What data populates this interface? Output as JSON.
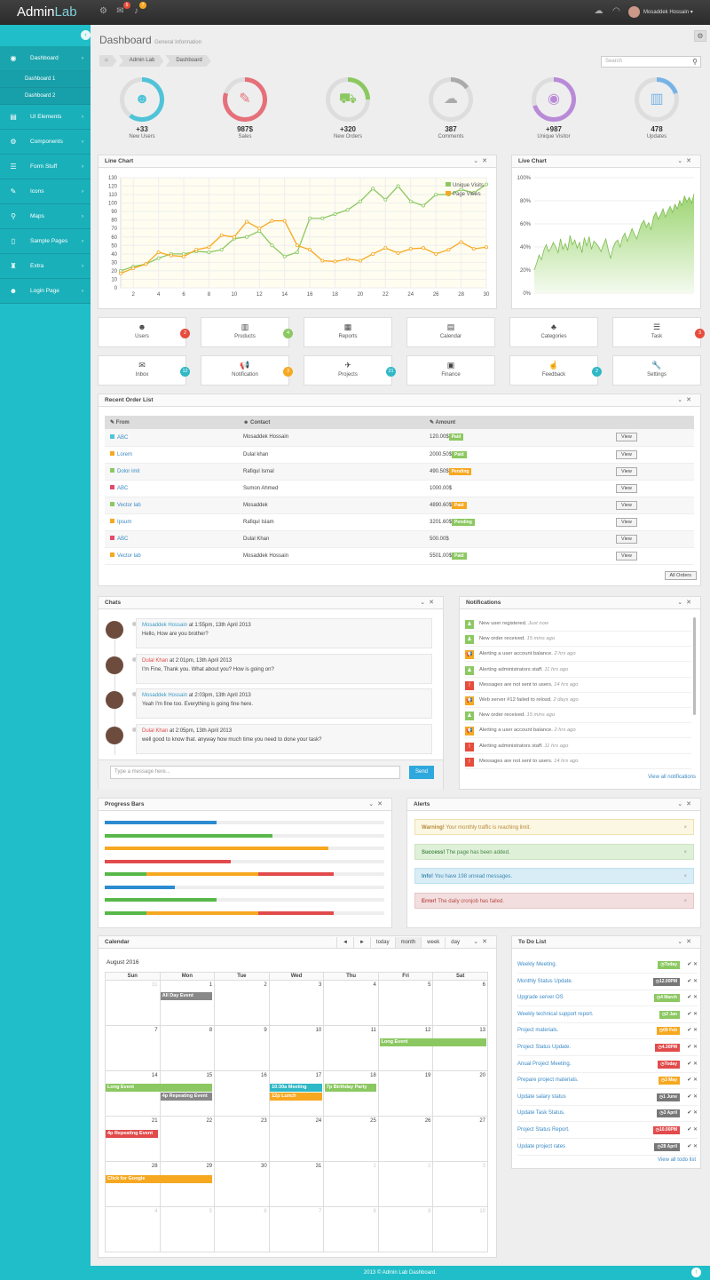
{
  "app": {
    "logo_a": "Admin",
    "logo_b": "Lab",
    "user": "Mosaddek Hossain",
    "mail_badge": "5",
    "bell_badge": "7"
  },
  "sidebar": {
    "items": [
      {
        "label": "Dashboard",
        "icon": "dashboard-icon",
        "glyph": "◉"
      },
      {
        "label": "UI Elements",
        "icon": "book-icon",
        "glyph": "▤"
      },
      {
        "label": "Components",
        "icon": "cogs-icon",
        "glyph": "⚙"
      },
      {
        "label": "Form Stuff",
        "icon": "list-icon",
        "glyph": "☰"
      },
      {
        "label": "Icons",
        "icon": "tint-icon",
        "glyph": "✎"
      },
      {
        "label": "Maps",
        "icon": "map-marker-icon",
        "glyph": "⚲"
      },
      {
        "label": "Sample Pages",
        "icon": "file-icon",
        "glyph": "▯"
      },
      {
        "label": "Extra",
        "icon": "trophy-icon",
        "glyph": "♜"
      },
      {
        "label": "Login Page",
        "icon": "user-icon",
        "glyph": "☻"
      }
    ],
    "sub": [
      "Dashboard 1",
      "Dashboard 2"
    ]
  },
  "page": {
    "title": "Dashboard",
    "subtitle": "General Information",
    "breadcrumb": [
      "⌂",
      "Admin Lab",
      "Dashboard"
    ],
    "search_placeholder": "Search"
  },
  "stats": [
    {
      "value": "+33",
      "label": "New Users",
      "color": "#4fc3d8",
      "pct": 0.6,
      "glyph": "☻"
    },
    {
      "value": "987$",
      "label": "Sales",
      "color": "#e5707a",
      "pct": 0.8,
      "glyph": "✎"
    },
    {
      "value": "+320",
      "label": "New Orders",
      "color": "#8cc862",
      "pct": 0.25,
      "glyph": "⛟"
    },
    {
      "value": "387",
      "label": "Comments",
      "color": "#aaaaaa",
      "pct": 0.15,
      "glyph": "☁"
    },
    {
      "value": "+987",
      "label": "Unique Visitor",
      "color": "#b98ad8",
      "pct": 0.7,
      "glyph": "◉"
    },
    {
      "value": "478",
      "label": "Updates",
      "color": "#79b3e5",
      "pct": 0.2,
      "glyph": "▥"
    }
  ],
  "line_panel": {
    "title": "Line Chart"
  },
  "live_panel": {
    "title": "Live Chart"
  },
  "chart_data": [
    {
      "type": "line",
      "ylim": [
        0,
        130
      ],
      "yticks": [
        0,
        10,
        20,
        30,
        40,
        50,
        60,
        70,
        80,
        90,
        100,
        110,
        120,
        130
      ],
      "xticks": [
        2,
        4,
        6,
        8,
        10,
        12,
        14,
        16,
        18,
        20,
        22,
        24,
        26,
        28,
        30
      ],
      "x": [
        1,
        2,
        3,
        4,
        5,
        6,
        7,
        8,
        9,
        10,
        11,
        12,
        13,
        14,
        15,
        16,
        17,
        18,
        19,
        20,
        21,
        22,
        23,
        24,
        25,
        26,
        27,
        28,
        29,
        30
      ],
      "series": [
        {
          "name": "Unique Visits",
          "color": "#8cc862",
          "values": [
            20,
            25,
            28,
            35,
            40,
            40,
            43,
            42,
            45,
            58,
            60,
            67,
            50,
            37,
            42,
            82,
            82,
            87,
            92,
            102,
            117,
            104,
            120,
            102,
            97,
            110,
            110,
            116,
            112,
            122
          ]
        },
        {
          "name": "Page Views",
          "color": "#f6a821",
          "values": [
            17,
            23,
            28,
            42,
            38,
            37,
            45,
            48,
            62,
            60,
            78,
            70,
            79,
            79,
            50,
            45,
            32,
            31,
            34,
            32,
            40,
            47,
            41,
            46,
            47,
            40,
            45,
            54,
            46,
            48
          ]
        }
      ]
    },
    {
      "type": "area",
      "ylim": [
        0,
        100
      ],
      "yticks": [
        "0%",
        "20%",
        "40%",
        "60%",
        "80%",
        "100%"
      ],
      "series": [
        {
          "color": "#9cd472",
          "values": [
            20,
            26,
            33,
            29,
            37,
            42,
            36,
            39,
            44,
            40,
            35,
            47,
            38,
            43,
            37,
            50,
            42,
            46,
            39,
            44,
            35,
            48,
            41,
            49,
            38,
            45,
            43,
            40,
            36,
            42,
            47,
            38,
            30,
            39,
            44,
            46,
            40,
            48,
            52,
            45,
            50,
            56,
            51,
            47,
            54,
            60,
            63,
            57,
            61,
            55,
            66,
            70,
            64,
            68,
            73,
            66,
            71,
            75,
            70,
            77,
            73,
            80,
            76,
            84,
            79,
            83,
            78,
            86
          ]
        }
      ]
    }
  ],
  "tiles": [
    {
      "label": "Users",
      "glyph": "☻",
      "icon": "users-icon",
      "badge": "2",
      "bcolor": "#e74c3c"
    },
    {
      "label": "Products",
      "glyph": "▥",
      "icon": "barcode-icon",
      "badge": "4",
      "bcolor": "#8cc862"
    },
    {
      "label": "Reports",
      "glyph": "▦",
      "icon": "bar-chart-icon",
      "badge": "",
      "bcolor": ""
    },
    {
      "label": "Calendar",
      "glyph": "▤",
      "icon": "calendar-icon",
      "badge": "",
      "bcolor": ""
    },
    {
      "label": "Categories",
      "glyph": "♣",
      "icon": "sitemap-icon",
      "badge": "",
      "bcolor": ""
    },
    {
      "label": "Task",
      "glyph": "☰",
      "icon": "tasks-icon",
      "badge": "3",
      "bcolor": "#e74c3c"
    },
    {
      "label": "Inbox",
      "glyph": "✉",
      "icon": "inbox-icon",
      "badge": "12",
      "bcolor": "#2fb8c6"
    },
    {
      "label": "Notification",
      "glyph": "📢",
      "icon": "bullhorn-icon",
      "badge": "3",
      "bcolor": "#f6a821"
    },
    {
      "label": "Projects",
      "glyph": "✈",
      "icon": "plane-icon",
      "badge": "21",
      "bcolor": "#2fb8c6"
    },
    {
      "label": "Finance",
      "glyph": "▣",
      "icon": "money-icon",
      "badge": "",
      "bcolor": ""
    },
    {
      "label": "Feedback",
      "glyph": "☝",
      "icon": "thumbs-up-icon",
      "badge": "2",
      "bcolor": "#2fb8c6"
    },
    {
      "label": "Settings",
      "glyph": "🔧",
      "icon": "wrench-icon",
      "badge": "",
      "bcolor": ""
    }
  ],
  "orders": {
    "title": "Recent Order List",
    "headers": [
      "From",
      "Contact",
      "Amount"
    ],
    "view_label": "View",
    "all_label": "All Orders",
    "rows": [
      {
        "from": "ABC",
        "color": "#4fc3d8",
        "contact": "Mosaddek Hossain",
        "amount": "120.00$",
        "status": "Paid",
        "scolor": "#8cc862"
      },
      {
        "from": "Lorem",
        "color": "#f6a821",
        "contact": "Dulal khan",
        "amount": "2000.50$",
        "status": "Paid",
        "scolor": "#8cc862"
      },
      {
        "from": "Dolor imit",
        "color": "#8cc862",
        "contact": "Rafiqul Ismal",
        "amount": "490.50$",
        "status": "Pending",
        "scolor": "#f6a821"
      },
      {
        "from": "ABC",
        "color": "#e24b6b",
        "contact": "Sumon Ahmed",
        "amount": "1000.00$",
        "status": "",
        "scolor": ""
      },
      {
        "from": "Vector lab",
        "color": "#8cc862",
        "contact": "Mosaddek",
        "amount": "4890.60$",
        "status": "Paid",
        "scolor": "#f6a821"
      },
      {
        "from": "Ipsum",
        "color": "#f6a821",
        "contact": "Rafiqul Islam",
        "amount": "3201.60$",
        "status": "Pending",
        "scolor": "#8cc862"
      },
      {
        "from": "ABC",
        "color": "#e24b6b",
        "contact": "Dulal Khan",
        "amount": "500.00$",
        "status": "",
        "scolor": ""
      },
      {
        "from": "Vector lab",
        "color": "#f6a821",
        "contact": "Mosaddek Hossain",
        "amount": "5501.00$",
        "status": "Paid",
        "scolor": "#8cc862"
      }
    ]
  },
  "chats": {
    "title": "Chats",
    "placeholder": "Type a message here...",
    "send": "Send",
    "messages": [
      {
        "who": "Mosaddek Hossain",
        "at": "at 1:55pm, 13th April 2013",
        "text": "Hello, How are you brother?",
        "red": false
      },
      {
        "who": "Dulal Khan",
        "at": "at 2:01pm, 13th April 2013",
        "text": "I'm Fine, Thank you. What about you? How is going on?",
        "red": true
      },
      {
        "who": "Mosaddek Hossain",
        "at": "at 2:03pm, 13th April 2013",
        "text": "Yeah I'm fine too. Everything is going fine here.",
        "red": false
      },
      {
        "who": "Dulal Khan",
        "at": "at 2:05pm, 13th April 2013",
        "text": "well good to know that. anyway how much time you need to done your task?",
        "red": true
      }
    ]
  },
  "notifications": {
    "title": "Notifications",
    "view_all": "View all notifications",
    "items": [
      {
        "text": "New user registered.",
        "time": "Just now",
        "color": "#8cc862",
        "glyph": "♟"
      },
      {
        "text": "New order received.",
        "time": "15 mins ago",
        "color": "#8cc862",
        "glyph": "♟"
      },
      {
        "text": "Alerting a user account balance.",
        "time": "2 hrs ago",
        "color": "#f6a821",
        "glyph": "📢"
      },
      {
        "text": "Alerting administrators staff.",
        "time": "11 hrs ago",
        "color": "#8cc862",
        "glyph": "♟"
      },
      {
        "text": "Messages are not sent to users.",
        "time": "14 hrs ago",
        "color": "#e74c3c",
        "glyph": "!"
      },
      {
        "text": "Web server #12 failed to relosd.",
        "time": "2 days ago",
        "color": "#f6a821",
        "glyph": "📢"
      },
      {
        "text": "New order received.",
        "time": "15 mins ago",
        "color": "#8cc862",
        "glyph": "♟"
      },
      {
        "text": "Alerting a user account balance.",
        "time": "2 hrs ago",
        "color": "#f6a821",
        "glyph": "📢"
      },
      {
        "text": "Alerting administrators staff.",
        "time": "11 hrs ago",
        "color": "#e74c3c",
        "glyph": "!"
      },
      {
        "text": "Messages are not sent to users.",
        "time": "14 hrs ago",
        "color": "#e74c3c",
        "glyph": "!"
      }
    ]
  },
  "progress": {
    "title": "Progress Bars",
    "bars": [
      [
        {
          "c": "#2d8bd0",
          "v": 0.4
        }
      ],
      [
        {
          "c": "#57b849",
          "v": 0.6
        }
      ],
      [
        {
          "c": "#f6a821",
          "v": 0.8
        }
      ],
      [
        {
          "c": "#e24b4b",
          "v": 0.45
        }
      ],
      [
        {
          "c": "#57b849",
          "v": 0.15
        },
        {
          "c": "#f6a821",
          "v": 0.4
        },
        {
          "c": "#e24b4b",
          "v": 0.27
        }
      ],
      [
        {
          "c": "#2d8bd0",
          "v": 0.25
        }
      ],
      [
        {
          "c": "#57b849",
          "v": 0.4
        }
      ],
      [
        {
          "c": "#57b849",
          "v": 0.15
        },
        {
          "c": "#f6a821",
          "v": 0.4
        },
        {
          "c": "#e24b4b",
          "v": 0.27
        }
      ]
    ]
  },
  "alerts": {
    "title": "Alerts",
    "items": [
      {
        "strong": "Warning!",
        "text": "Your monthly traffic is reaching limit.",
        "bg": "#fcf7e2",
        "bd": "#f0e1b0",
        "fg": "#b5893b"
      },
      {
        "strong": "Success!",
        "text": "The page has been added.",
        "bg": "#dff0d8",
        "bd": "#cde3c2",
        "fg": "#468847"
      },
      {
        "strong": "Info!",
        "text": "You have 198 unread messages.",
        "bg": "#d9edf7",
        "bd": "#bde0ee",
        "fg": "#3a87ad"
      },
      {
        "strong": "Error!",
        "text": "The daily cronjob has failed.",
        "bg": "#f2dede",
        "bd": "#e6c5c5",
        "fg": "#b94a48"
      }
    ]
  },
  "calendar": {
    "title": "Calendar",
    "month": "August 2016",
    "buttons": [
      "◄",
      "►",
      "today",
      "month",
      "week",
      "day"
    ],
    "days": [
      "Sun",
      "Mon",
      "Tue",
      "Wed",
      "Thu",
      "Fri",
      "Sat"
    ],
    "weeks": [
      [
        "31",
        "1",
        "2",
        "3",
        "4",
        "5",
        "6"
      ],
      [
        "7",
        "8",
        "9",
        "10",
        "11",
        "12",
        "13"
      ],
      [
        "14",
        "15",
        "16",
        "17",
        "18",
        "19",
        "20"
      ],
      [
        "21",
        "22",
        "23",
        "24",
        "25",
        "26",
        "27"
      ],
      [
        "28",
        "29",
        "30",
        "31",
        "1",
        "2",
        "3"
      ],
      [
        "4",
        "5",
        "6",
        "7",
        "8",
        "9",
        "10"
      ]
    ],
    "events": [
      {
        "label": "All Day Event",
        "color": "#888888"
      },
      {
        "label": "Long Event",
        "color": "#8cc862"
      },
      {
        "label": "Long Event",
        "color": "#8cc862"
      },
      {
        "label": "4p Repeating Event",
        "color": "#888888"
      },
      {
        "label": "10:30a Meeting",
        "color": "#2fb8c6"
      },
      {
        "label": "12p Lunch",
        "color": "#f6a821"
      },
      {
        "label": "7p Birthday Party",
        "color": "#8cc862"
      },
      {
        "label": "4p Repeating Event",
        "color": "#e24b4b"
      },
      {
        "label": "Click for Google",
        "color": "#f6a821"
      }
    ]
  },
  "todo": {
    "title": "To Do List",
    "view_all": "View all todo list",
    "items": [
      {
        "task": "Weekly Meeting.",
        "tag": "Today",
        "color": "#8cc862"
      },
      {
        "task": "Monthly Status Update.",
        "tag": "12.00PM",
        "color": "#777777"
      },
      {
        "task": "Upgrade server OS",
        "tag": "4 March",
        "color": "#8cc862"
      },
      {
        "task": "Weekly technical support report.",
        "tag": "2 Jan",
        "color": "#8cc862"
      },
      {
        "task": "Project materials.",
        "tag": "09 Feb",
        "color": "#f6a821"
      },
      {
        "task": "Project Status Update.",
        "tag": "4.30PM",
        "color": "#e24b4b"
      },
      {
        "task": "Anual Project Meeting.",
        "tag": "Today",
        "color": "#e24b4b"
      },
      {
        "task": "Prepare project materials.",
        "tag": "3 May",
        "color": "#f6a821"
      },
      {
        "task": "Update salary status",
        "tag": "1 June",
        "color": "#777777"
      },
      {
        "task": "Update Task Status.",
        "tag": "3 April",
        "color": "#777777"
      },
      {
        "task": "Project Status Report.",
        "tag": "10.00PM",
        "color": "#e24b4b"
      },
      {
        "task": "Update project rates",
        "tag": "28 April",
        "color": "#777777"
      }
    ]
  },
  "footer": "2013 © Admin Lab Dashboard."
}
